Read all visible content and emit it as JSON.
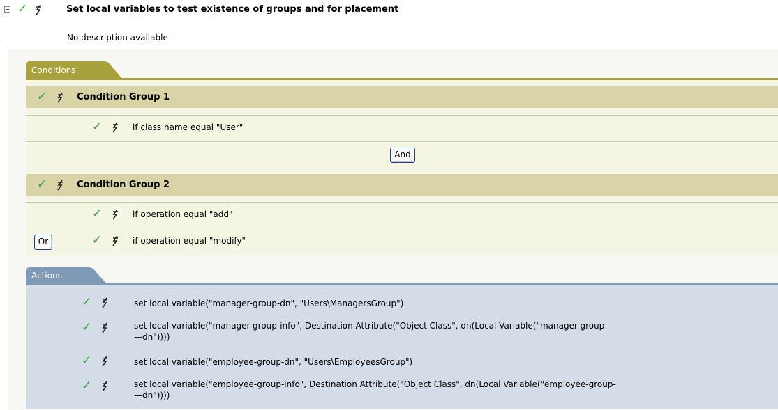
{
  "rule": {
    "title": "Set local variables to test existence of groups and for placement",
    "description": "No description available"
  },
  "conditions": {
    "tab_label": "Conditions",
    "groups": [
      {
        "title": "Condition Group 1",
        "items": [
          "if class name equal \"User\""
        ]
      },
      {
        "title": "Condition Group 2",
        "items": [
          "if operation equal \"add\"",
          "if operation equal \"modify\""
        ]
      }
    ],
    "and_button": "And",
    "or_button": "Or"
  },
  "actions": {
    "tab_label": "Actions",
    "items": [
      "set local variable(\"manager-group-dn\", \"Users\\ManagersGroup\")",
      "set local variable(\"manager-group-info\", Destination Attribute(\"Object Class\", dn(Local Variable(\"manager-group-\n—dn\"))))",
      "set local variable(\"employee-group-dn\", \"Users\\EmployeesGroup\")",
      "set local variable(\"employee-group-info\", Destination Attribute(\"Object Class\", dn(Local Variable(\"employee-group-\n—dn\"))))"
    ]
  },
  "icons": {
    "check": "check-icon",
    "bolt": "lightning-icon",
    "expander": "collapse-icon"
  },
  "colors": {
    "check_green": "#3ba33b",
    "conditions_tab": "#a9a13c",
    "group_header": "#d8d4a8",
    "actions_tab": "#7e9ab6",
    "actions_bg": "#d4dde7"
  }
}
